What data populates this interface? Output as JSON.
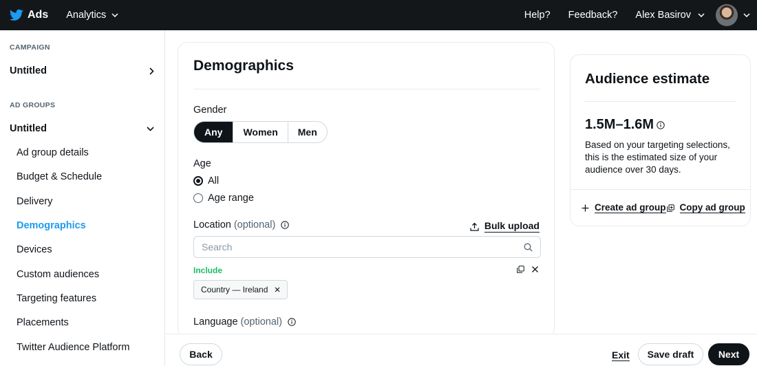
{
  "topbar": {
    "brand": "Ads",
    "nav_label": "Analytics",
    "help": "Help?",
    "feedback": "Feedback?",
    "user_name": "Alex Basirov"
  },
  "sidebar": {
    "campaign_heading": "CAMPAIGN",
    "campaign_name": "Untitled",
    "ad_groups_heading": "AD GROUPS",
    "ad_group_name": "Untitled",
    "items": [
      {
        "label": "Ad group details"
      },
      {
        "label": "Budget & Schedule"
      },
      {
        "label": "Delivery"
      },
      {
        "label": "Demographics",
        "active": true
      },
      {
        "label": "Devices"
      },
      {
        "label": "Custom audiences"
      },
      {
        "label": "Targeting features"
      },
      {
        "label": "Placements"
      },
      {
        "label": "Twitter Audience Platform"
      }
    ]
  },
  "main": {
    "title": "Demographics",
    "gender": {
      "label": "Gender",
      "options": [
        "Any",
        "Women",
        "Men"
      ],
      "selected": "Any"
    },
    "age": {
      "label": "Age",
      "options": [
        "All",
        "Age range"
      ],
      "selected": "All"
    },
    "location": {
      "label": "Location",
      "optional": "(optional)",
      "bulk_upload": "Bulk upload",
      "search_placeholder": "Search",
      "include_label": "Include",
      "chip": "Country — Ireland"
    },
    "language": {
      "label": "Language",
      "optional": "(optional)"
    }
  },
  "audience": {
    "title": "Audience estimate",
    "estimate": "1.5M–1.6M",
    "description": "Based on your targeting selections, this is the estimated size of your audience over 30 days.",
    "create_label": "Create ad group",
    "copy_label": "Copy ad group"
  },
  "bottombar": {
    "back": "Back",
    "exit": "Exit",
    "save_draft": "Save draft",
    "next": "Next"
  },
  "colors": {
    "topbar_bg": "#14171a",
    "accent": "#1d9bf0",
    "include_green": "#17bf63",
    "primary_button": "#0f1419"
  },
  "icons": [
    "twitter-bird-icon",
    "chevron-down-icon",
    "chevron-right-icon",
    "info-icon",
    "upload-icon",
    "search-icon",
    "copy-icon",
    "close-icon",
    "plus-icon"
  ]
}
